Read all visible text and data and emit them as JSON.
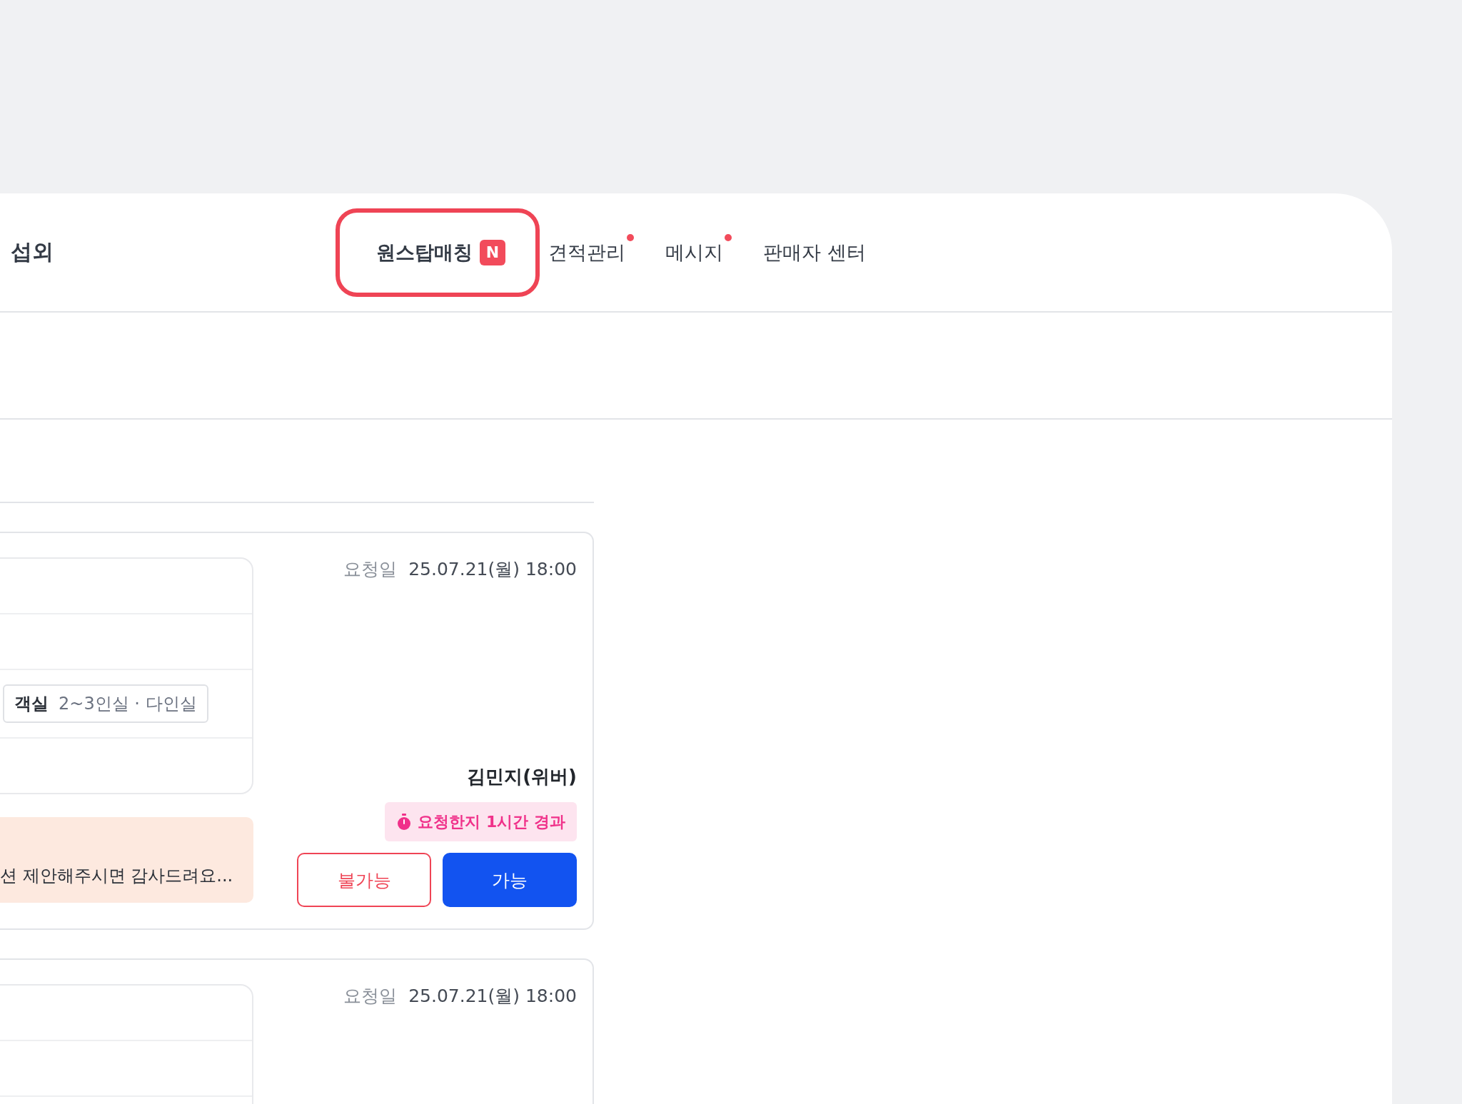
{
  "header": {
    "title": "섭외",
    "tabs": [
      {
        "label": "원스탑매칭",
        "badge": "N",
        "highlighted": true,
        "dot": false
      },
      {
        "label": "견적관리",
        "highlighted": false,
        "dot": true
      },
      {
        "label": "메시지",
        "highlighted": false,
        "dot": true
      },
      {
        "label": "판매자 센터",
        "highlighted": false,
        "dot": false
      }
    ]
  },
  "requests": [
    {
      "date_label": "요청일",
      "date": "25.07.21(월) 18:00",
      "room_label": "객실",
      "room_value": "2~3인실 · 다인실",
      "memo": "션 제안해주시면 감사드려요...",
      "requester": "김민지(위버)",
      "elapsed": "요청한지 1시간 경과",
      "buttons": [
        {
          "label": "불가능",
          "kind": "reject"
        },
        {
          "label": "가능",
          "kind": "accept"
        }
      ]
    },
    {
      "date_label": "요청일",
      "date": "25.07.21(월) 18:00"
    }
  ]
}
